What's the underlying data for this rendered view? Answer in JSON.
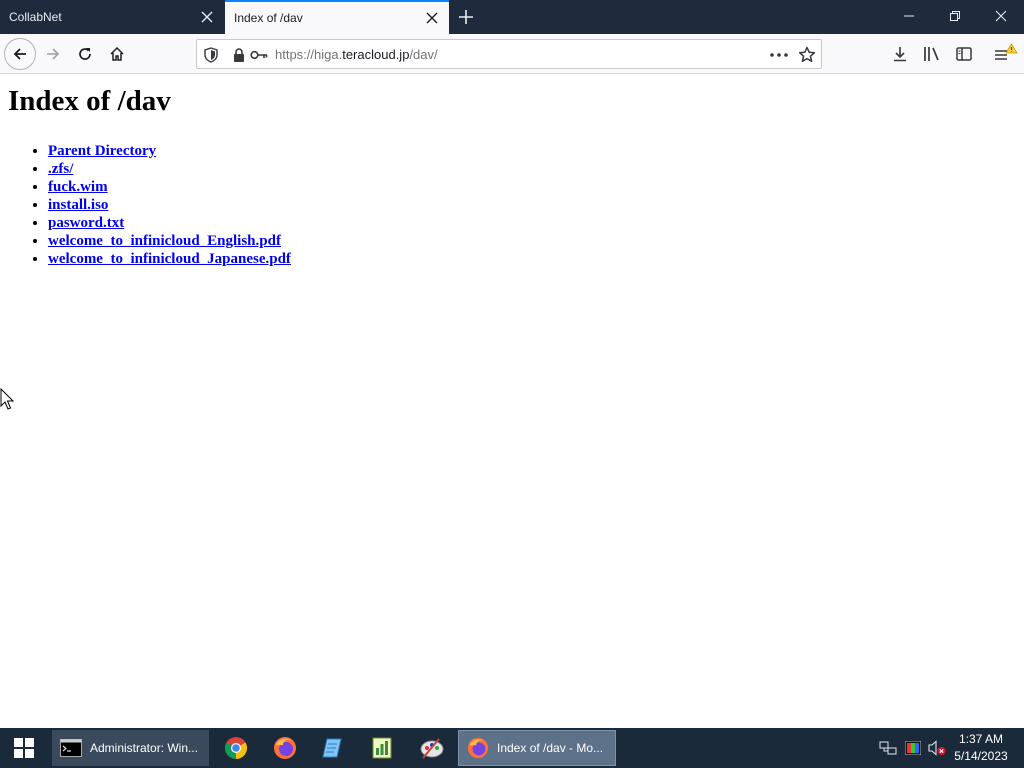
{
  "browser": {
    "tabs": [
      {
        "title": "CollabNet",
        "active": false
      },
      {
        "title": "Index of /dav",
        "active": true
      }
    ],
    "url": {
      "prefix": "https://higa.",
      "host": "teracloud.jp",
      "path": "/dav/"
    },
    "accent_color": "#0a84ff"
  },
  "page": {
    "heading": "Index of /dav",
    "links": [
      "Parent Directory",
      ".zfs/",
      "fuck.wim",
      "install.iso",
      "pasword.txt",
      "welcome_to_infinicloud_English.pdf",
      "welcome_to_infinicloud_Japanese.pdf"
    ],
    "link_color": "#0000ee"
  },
  "taskbar": {
    "cmd_label": "Administrator: Win...",
    "firefox_label": "Index of /dav - Mo...",
    "icons": [
      "windows-start-icon",
      "cmd-icon",
      "chrome-icon",
      "firefox-icon",
      "notepad-icon",
      "spreadsheet-icon",
      "paint-icon"
    ],
    "clock": {
      "time": "1:37 AM",
      "date": "5/14/2023"
    }
  }
}
